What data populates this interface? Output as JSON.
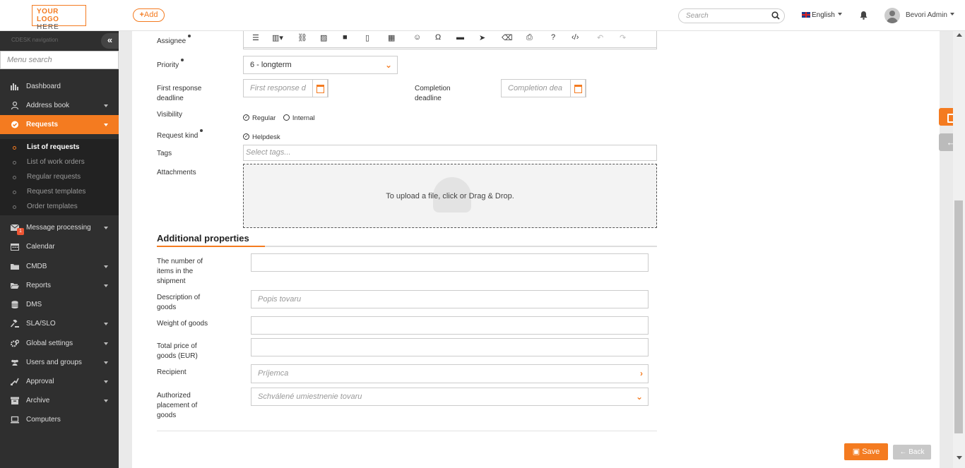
{
  "header": {
    "logo_line1": "YOUR LOGO",
    "logo_line2": "HERE",
    "add_label": "Add",
    "search_placeholder": "Search",
    "language": "English",
    "user_name": "Bevori Admin"
  },
  "sidebar": {
    "title": "CDESK navigation",
    "menu_search_placeholder": "Menu search",
    "items": [
      {
        "label": "Dashboard",
        "icon": "dashboard-icon"
      },
      {
        "label": "Address book",
        "icon": "user-icon"
      },
      {
        "label": "Requests",
        "icon": "check-circle-icon",
        "active": true
      },
      {
        "label": "Message processing",
        "icon": "envelope-icon",
        "badge": "1"
      },
      {
        "label": "Calendar",
        "icon": "calendar-icon"
      },
      {
        "label": "CMDB",
        "icon": "folder-icon"
      },
      {
        "label": "Reports",
        "icon": "folder-open-icon"
      },
      {
        "label": "DMS",
        "icon": "database-icon"
      },
      {
        "label": "SLA/SLO",
        "icon": "gavel-icon"
      },
      {
        "label": "Global settings",
        "icon": "gears-icon"
      },
      {
        "label": "Users and groups",
        "icon": "users-icon"
      },
      {
        "label": "Approval",
        "icon": "thumbs-icon"
      },
      {
        "label": "Archive",
        "icon": "archive-icon"
      },
      {
        "label": "Computers",
        "icon": "laptop-icon"
      }
    ],
    "sub_items": [
      {
        "label": "List of requests",
        "active": true
      },
      {
        "label": "List of work orders"
      },
      {
        "label": "Regular requests"
      },
      {
        "label": "Request templates"
      },
      {
        "label": "Order templates"
      }
    ]
  },
  "form": {
    "assignee_label": "Assignee",
    "priority_label": "Priority",
    "priority_value": "6 - longterm",
    "first_response_label": "First response deadline",
    "first_response_placeholder": "First response d",
    "completion_label": "Completion deadline",
    "completion_placeholder": "Completion dea",
    "visibility_label": "Visibility",
    "visibility_regular": "Regular",
    "visibility_internal": "Internal",
    "request_kind_label": "Request kind",
    "request_kind_value": "Helpdesk",
    "tags_label": "Tags",
    "tags_placeholder": "Select tags...",
    "attachments_label": "Attachments",
    "upload_text": "To upload a file, click or Drag & Drop."
  },
  "additional": {
    "title": "Additional properties",
    "items_label": "The number of items in the shipment",
    "description_label": "Description of goods",
    "description_placeholder": "Popis tovaru",
    "weight_label": "Weight of goods",
    "total_price_label": "Total price of goods (EUR)",
    "recipient_label": "Recipient",
    "recipient_placeholder": "Príjemca",
    "placement_label": "Authorized placement of goods",
    "placement_placeholder": "Schválené umiestnenie tovaru"
  },
  "actions": {
    "save_label": "Save",
    "back_label": "Back"
  },
  "colors": {
    "accent": "#f47b20",
    "sidebar_bg": "#2f2f2f"
  }
}
